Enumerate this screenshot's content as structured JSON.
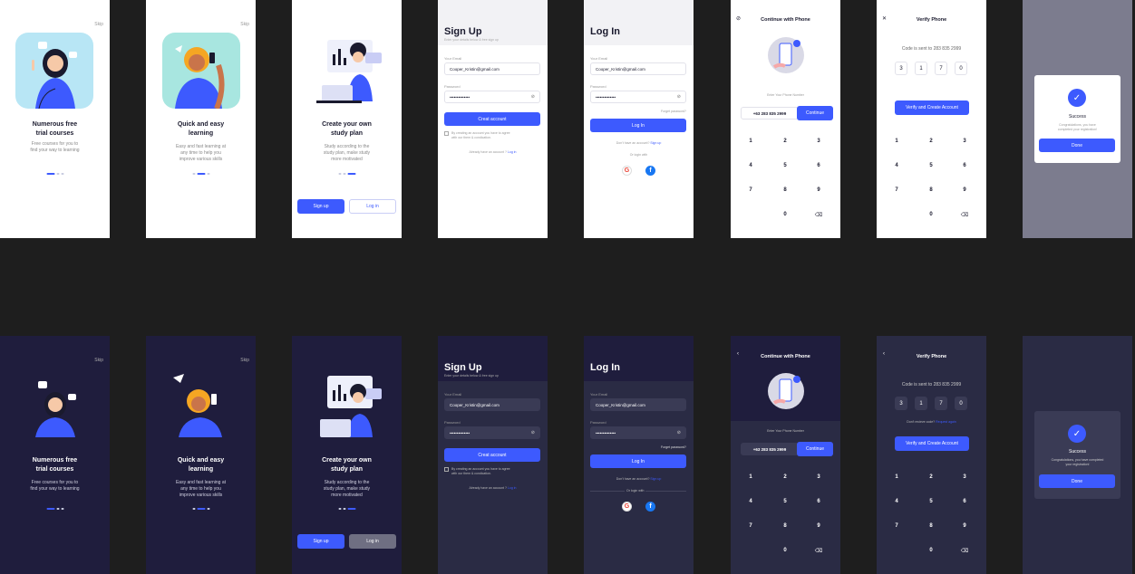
{
  "onboarding": [
    {
      "skip": "Skip",
      "title_line1": "Numerous free",
      "title_line2": "trial courses",
      "desc_line1": "Free courses for you to",
      "desc_line2": "find your way to learning"
    },
    {
      "skip": "Skip",
      "title_line1": "Quick and easy",
      "title_line2": "learning",
      "desc_line1": "Easy and fast learning at",
      "desc_line2": "any time to help you",
      "desc_line3": "improve various skills"
    },
    {
      "title_line1": "Create your own",
      "title_line2": "study plan",
      "desc_line1": "Study according to the",
      "desc_line2": "study plan, make study",
      "desc_line3": "more motivated",
      "signup_label": "Sign up",
      "login_label": "Log in"
    }
  ],
  "signup": {
    "title": "Sign Up",
    "subtitle": "Enter your details below & free sign up",
    "email_label": "Your Email",
    "email_value": "Cooper_Kristin@gmail.com",
    "password_label": "Password",
    "password_value": "••••••••••••••",
    "create_label": "Creat account",
    "terms_line1": "By creating an account you have to agree",
    "terms_line2": "with our them & condication.",
    "have_account": "Already have an account ?",
    "login_link": "Log in"
  },
  "login": {
    "title": "Log In",
    "email_label": "Your Email",
    "email_value": "Cooper_Kristin@gmail.com",
    "password_label": "Password",
    "password_value": "••••••••••••••",
    "forgot": "Forget password?",
    "login_label": "Log In",
    "no_account": "Don't have an account?",
    "signup_link": "Sign up",
    "or_login": "Or login with",
    "google_glyph": "G",
    "facebook_glyph": "f"
  },
  "phone": {
    "title": "Continue with Phone",
    "enter_label": "Enter Your Phone Number",
    "phone_value": "+63 283 835 2999",
    "continue_label": "Continue"
  },
  "verify": {
    "title": "Verify Phone",
    "code_sent": "Code is sent to 283 835 2999",
    "code_digits": [
      "3",
      "1",
      "7",
      "0"
    ],
    "no_code": "Don't recieve code?",
    "request_again": "Request again",
    "verify_label": "Verify and Create Account"
  },
  "keypad": {
    "rows": [
      [
        "1",
        "2",
        "3"
      ],
      [
        "4",
        "5",
        "6"
      ],
      [
        "7",
        "8",
        "9"
      ],
      [
        "",
        "0",
        "⌫"
      ]
    ]
  },
  "success": {
    "check_glyph": "✓",
    "title": "Success",
    "msg_line1": "Congratulations, you have",
    "msg_line2": "completed your registration!",
    "dark_msg_line1": "Congratulations, you have completed",
    "dark_msg_line2": "your registration!",
    "done_label": "Done"
  },
  "colors": {
    "accent": "#3d5afe",
    "dark_bg": "#1f1d3d",
    "canvas": "#1e1e1e"
  }
}
